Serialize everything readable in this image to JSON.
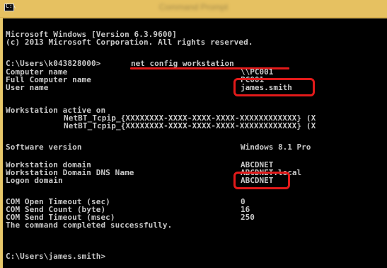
{
  "window": {
    "title": "Command Prompt",
    "icon": "cmd-prompt-icon"
  },
  "console": {
    "banner": [
      "Microsoft Windows [Version 6.3.9600]",
      "(c) 2013 Microsoft Corporation. All rights reserved."
    ],
    "command_prompt": "C:\\Users\\k043828000>",
    "command": "net config workstation",
    "fields": [
      {
        "label": "Computer name",
        "value": "\\\\PC001"
      },
      {
        "label": "Full Computer name",
        "value": "PC001"
      },
      {
        "label": "User name",
        "value": "james.smith"
      }
    ],
    "workstation_heading": "Workstation active on",
    "transports": [
      "NetBT_Tcpip_{XXXXXXXX-XXXX-XXXX-XXXX-XXXXXXXXXXXX} (X",
      "NetBT_Tcpip_{XXXXXXXX-XXXX-XXXX-XXXX-XXXXXXXXXXXX} (X"
    ],
    "software_version": {
      "label": "Software version",
      "value": "Windows 8.1 Pro"
    },
    "domain_fields": [
      {
        "label": "Workstation domain",
        "value": "ABCDNET"
      },
      {
        "label": "Workstation Domain DNS Name",
        "value": "ABCDNET.local"
      },
      {
        "label": "Logon domain",
        "value": "ABCDNET"
      }
    ],
    "com_fields": [
      {
        "label": "COM Open Timeout (sec)",
        "value": "0"
      },
      {
        "label": "COM Send Count (byte)",
        "value": "16"
      },
      {
        "label": "COM Send Timeout (msec)",
        "value": "250"
      }
    ],
    "completion": "The command completed successfully.",
    "final_prompt": "C:\\Users\\james.smith>"
  },
  "highlight_color": "#e21a1a"
}
